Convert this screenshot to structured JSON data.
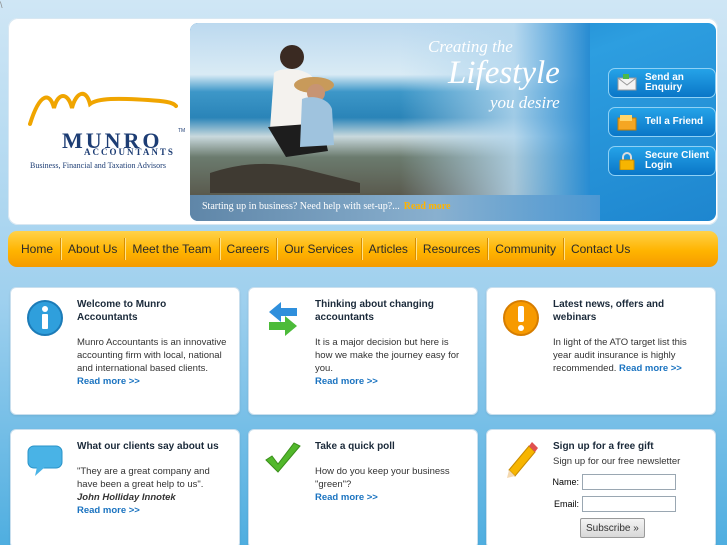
{
  "corner_mark": "\\",
  "logo": {
    "name": "MUNRO",
    "sub": "ACCOUNTANTS",
    "tagline": "Business, Financial and Taxation Advisors",
    "tm": "TM"
  },
  "hero": {
    "line1": "Creating the",
    "line2": "Lifestyle",
    "line3": "you desire",
    "caption": "Starting up in business? Need help with set-up?...",
    "caption_more": "Read more"
  },
  "side_buttons": [
    {
      "label": "Send an Enquiry",
      "icon": "envelope-icon"
    },
    {
      "label": "Tell a Friend",
      "icon": "folder-icon"
    },
    {
      "label": "Secure Client Login",
      "icon": "padlock-icon"
    }
  ],
  "nav": [
    "Home",
    "About Us",
    "Meet the Team",
    "Careers",
    "Our Services",
    "Articles",
    "Resources",
    "Community",
    "Contact Us"
  ],
  "cards": {
    "welcome": {
      "title": "Welcome to Munro Accountants",
      "text": "Munro Accountants is an innovative accounting firm with local, national and international based clients.",
      "more": "Read more >>",
      "icon": "info-icon"
    },
    "changing": {
      "title": "Thinking about changing accountants",
      "text": "It is a major decision but here is how we make the journey easy for you.",
      "more": "Read more >>",
      "icon": "switch-arrows-icon"
    },
    "news": {
      "title": "Latest news, offers and webinars",
      "text": "In light of the ATO target list this year audit insurance is highly recommended.",
      "more": "Read more >>",
      "icon": "alert-icon"
    },
    "clients": {
      "title": "What our clients say about us",
      "text": "\"They are a great company and have been a great help to us\".",
      "author": "John Holliday Innotek",
      "more": "Read more >>",
      "icon": "speech-bubble-icon"
    },
    "poll": {
      "title": "Take a quick poll",
      "text": "How do you keep your business \"green\"?",
      "more": "Read more >>",
      "icon": "checkmark-icon"
    },
    "signup": {
      "title": "Sign up for a free gift",
      "text": "Sign up for our free newsletter",
      "name_label": "Name:",
      "email_label": "Email:",
      "button": "Subscribe »",
      "icon": "pencil-icon"
    }
  },
  "colors": {
    "nav_gold": "#ffb400",
    "brand_navy": "#1d3d74",
    "link_blue": "#1a73c0",
    "button_blue": "#0a76c7"
  }
}
